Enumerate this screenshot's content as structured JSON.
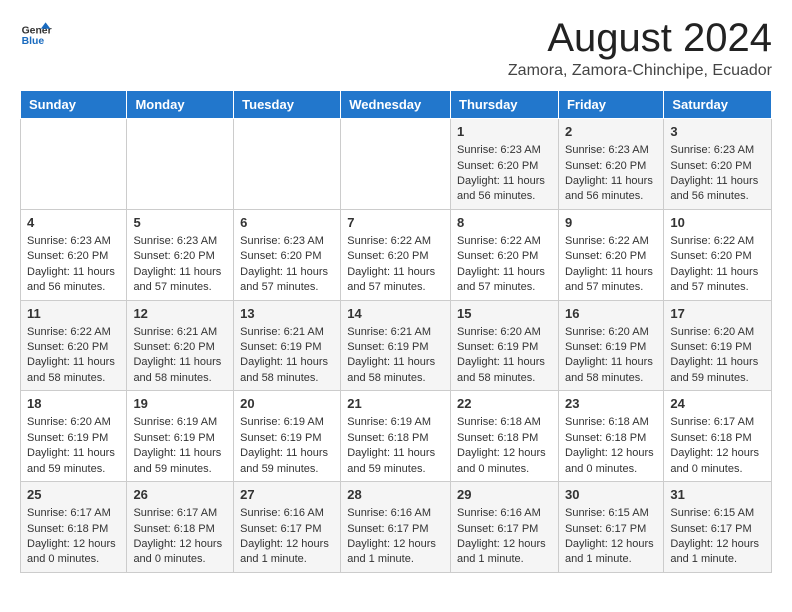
{
  "logo": {
    "text_general": "General",
    "text_blue": "Blue"
  },
  "header": {
    "main_title": "August 2024",
    "subtitle": "Zamora, Zamora-Chinchipe, Ecuador"
  },
  "calendar": {
    "days_of_week": [
      "Sunday",
      "Monday",
      "Tuesday",
      "Wednesday",
      "Thursday",
      "Friday",
      "Saturday"
    ],
    "weeks": [
      [
        {
          "day": "",
          "content": ""
        },
        {
          "day": "",
          "content": ""
        },
        {
          "day": "",
          "content": ""
        },
        {
          "day": "",
          "content": ""
        },
        {
          "day": "1",
          "content": "Sunrise: 6:23 AM\nSunset: 6:20 PM\nDaylight: 11 hours and 56 minutes."
        },
        {
          "day": "2",
          "content": "Sunrise: 6:23 AM\nSunset: 6:20 PM\nDaylight: 11 hours and 56 minutes."
        },
        {
          "day": "3",
          "content": "Sunrise: 6:23 AM\nSunset: 6:20 PM\nDaylight: 11 hours and 56 minutes."
        }
      ],
      [
        {
          "day": "4",
          "content": "Sunrise: 6:23 AM\nSunset: 6:20 PM\nDaylight: 11 hours and 56 minutes."
        },
        {
          "day": "5",
          "content": "Sunrise: 6:23 AM\nSunset: 6:20 PM\nDaylight: 11 hours and 57 minutes."
        },
        {
          "day": "6",
          "content": "Sunrise: 6:23 AM\nSunset: 6:20 PM\nDaylight: 11 hours and 57 minutes."
        },
        {
          "day": "7",
          "content": "Sunrise: 6:22 AM\nSunset: 6:20 PM\nDaylight: 11 hours and 57 minutes."
        },
        {
          "day": "8",
          "content": "Sunrise: 6:22 AM\nSunset: 6:20 PM\nDaylight: 11 hours and 57 minutes."
        },
        {
          "day": "9",
          "content": "Sunrise: 6:22 AM\nSunset: 6:20 PM\nDaylight: 11 hours and 57 minutes."
        },
        {
          "day": "10",
          "content": "Sunrise: 6:22 AM\nSunset: 6:20 PM\nDaylight: 11 hours and 57 minutes."
        }
      ],
      [
        {
          "day": "11",
          "content": "Sunrise: 6:22 AM\nSunset: 6:20 PM\nDaylight: 11 hours and 58 minutes."
        },
        {
          "day": "12",
          "content": "Sunrise: 6:21 AM\nSunset: 6:20 PM\nDaylight: 11 hours and 58 minutes."
        },
        {
          "day": "13",
          "content": "Sunrise: 6:21 AM\nSunset: 6:19 PM\nDaylight: 11 hours and 58 minutes."
        },
        {
          "day": "14",
          "content": "Sunrise: 6:21 AM\nSunset: 6:19 PM\nDaylight: 11 hours and 58 minutes."
        },
        {
          "day": "15",
          "content": "Sunrise: 6:20 AM\nSunset: 6:19 PM\nDaylight: 11 hours and 58 minutes."
        },
        {
          "day": "16",
          "content": "Sunrise: 6:20 AM\nSunset: 6:19 PM\nDaylight: 11 hours and 58 minutes."
        },
        {
          "day": "17",
          "content": "Sunrise: 6:20 AM\nSunset: 6:19 PM\nDaylight: 11 hours and 59 minutes."
        }
      ],
      [
        {
          "day": "18",
          "content": "Sunrise: 6:20 AM\nSunset: 6:19 PM\nDaylight: 11 hours and 59 minutes."
        },
        {
          "day": "19",
          "content": "Sunrise: 6:19 AM\nSunset: 6:19 PM\nDaylight: 11 hours and 59 minutes."
        },
        {
          "day": "20",
          "content": "Sunrise: 6:19 AM\nSunset: 6:19 PM\nDaylight: 11 hours and 59 minutes."
        },
        {
          "day": "21",
          "content": "Sunrise: 6:19 AM\nSunset: 6:18 PM\nDaylight: 11 hours and 59 minutes."
        },
        {
          "day": "22",
          "content": "Sunrise: 6:18 AM\nSunset: 6:18 PM\nDaylight: 12 hours and 0 minutes."
        },
        {
          "day": "23",
          "content": "Sunrise: 6:18 AM\nSunset: 6:18 PM\nDaylight: 12 hours and 0 minutes."
        },
        {
          "day": "24",
          "content": "Sunrise: 6:17 AM\nSunset: 6:18 PM\nDaylight: 12 hours and 0 minutes."
        }
      ],
      [
        {
          "day": "25",
          "content": "Sunrise: 6:17 AM\nSunset: 6:18 PM\nDaylight: 12 hours and 0 minutes."
        },
        {
          "day": "26",
          "content": "Sunrise: 6:17 AM\nSunset: 6:18 PM\nDaylight: 12 hours and 0 minutes."
        },
        {
          "day": "27",
          "content": "Sunrise: 6:16 AM\nSunset: 6:17 PM\nDaylight: 12 hours and 1 minute."
        },
        {
          "day": "28",
          "content": "Sunrise: 6:16 AM\nSunset: 6:17 PM\nDaylight: 12 hours and 1 minute."
        },
        {
          "day": "29",
          "content": "Sunrise: 6:16 AM\nSunset: 6:17 PM\nDaylight: 12 hours and 1 minute."
        },
        {
          "day": "30",
          "content": "Sunrise: 6:15 AM\nSunset: 6:17 PM\nDaylight: 12 hours and 1 minute."
        },
        {
          "day": "31",
          "content": "Sunrise: 6:15 AM\nSunset: 6:17 PM\nDaylight: 12 hours and 1 minute."
        }
      ]
    ]
  }
}
